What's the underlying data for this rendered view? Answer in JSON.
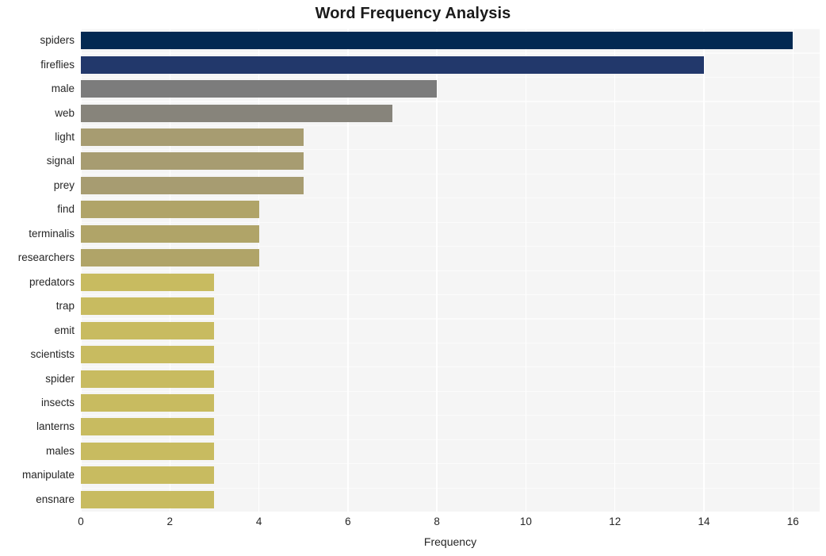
{
  "chart_data": {
    "type": "bar",
    "orientation": "horizontal",
    "title": "Word Frequency Analysis",
    "xlabel": "Frequency",
    "ylabel": "",
    "xlim": [
      0,
      16.6
    ],
    "xticks": [
      0,
      2,
      4,
      6,
      8,
      10,
      12,
      14,
      16
    ],
    "xtick_labels": [
      "0",
      "2",
      "4",
      "6",
      "8",
      "10",
      "12",
      "14",
      "16"
    ],
    "grid": true,
    "grid_axis": "both",
    "legend": false,
    "plot_background": "#f5f5f5",
    "figure_background": "#ffffff",
    "gridline_color": "#ffffff",
    "categories": [
      "spiders",
      "fireflies",
      "male",
      "web",
      "light",
      "signal",
      "prey",
      "find",
      "terminalis",
      "researchers",
      "predators",
      "trap",
      "emit",
      "scientists",
      "spider",
      "insects",
      "lanterns",
      "males",
      "manipulate",
      "ensnare"
    ],
    "values": [
      16,
      14,
      8,
      7,
      5,
      5,
      5,
      4,
      4,
      4,
      3,
      3,
      3,
      3,
      3,
      3,
      3,
      3,
      3,
      3
    ],
    "bar_colors": [
      "#032952",
      "#22386b",
      "#7c7c7c",
      "#87847b",
      "#a79c71",
      "#a79c71",
      "#a79c71",
      "#b0a468",
      "#b0a468",
      "#b0a468",
      "#c8bb60",
      "#c8bb60",
      "#c8bb60",
      "#c8bb60",
      "#c8bb60",
      "#c8bb60",
      "#c8bb60",
      "#c8bb60",
      "#c8bb60",
      "#c8bb60"
    ]
  }
}
